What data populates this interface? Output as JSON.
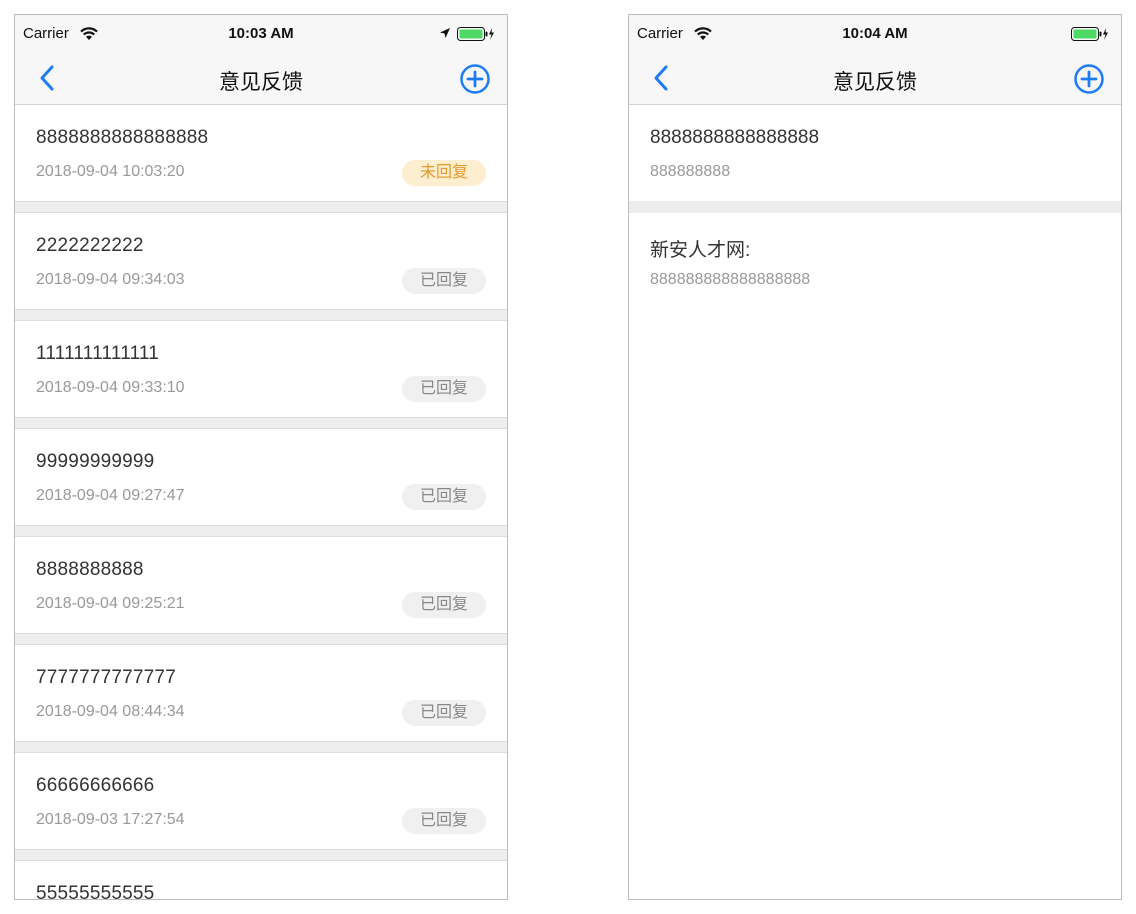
{
  "left_screen": {
    "status_bar": {
      "carrier": "Carrier",
      "time": "10:03 AM"
    },
    "nav": {
      "title": "意见反馈"
    },
    "items": [
      {
        "content": "8888888888888888",
        "date": "2018-09-04 10:03:20",
        "status": "未回复"
      },
      {
        "content": "2222222222",
        "date": "2018-09-04 09:34:03",
        "status": "已回复"
      },
      {
        "content": "1111111111111",
        "date": "2018-09-04 09:33:10",
        "status": "已回复"
      },
      {
        "content": "99999999999",
        "date": "2018-09-04 09:27:47",
        "status": "已回复"
      },
      {
        "content": "8888888888",
        "date": "2018-09-04 09:25:21",
        "status": "已回复"
      },
      {
        "content": "7777777777777",
        "date": "2018-09-04 08:44:34",
        "status": "已回复"
      },
      {
        "content": "66666666666",
        "date": "2018-09-03 17:27:54",
        "status": "已回复"
      },
      {
        "content": "55555555555",
        "date": "",
        "status": ""
      }
    ]
  },
  "right_screen": {
    "status_bar": {
      "carrier": "Carrier",
      "time": "10:04 AM"
    },
    "nav": {
      "title": "意见反馈"
    },
    "feedback": {
      "content": "8888888888888888",
      "subtext": "888888888"
    },
    "reply": {
      "label": "新安人才网:",
      "text": "888888888888888888"
    }
  },
  "colors": {
    "accent": "#1c7cf4",
    "unreplied_bg": "#fdeecf",
    "unreplied_text": "#e49b2c",
    "replied_bg": "#f0f0f0",
    "battery_green": "#4cd964"
  },
  "icons": [
    "wifi-icon",
    "location-arrow-icon",
    "battery-icon",
    "back-chevron-icon",
    "add-circle-icon"
  ]
}
